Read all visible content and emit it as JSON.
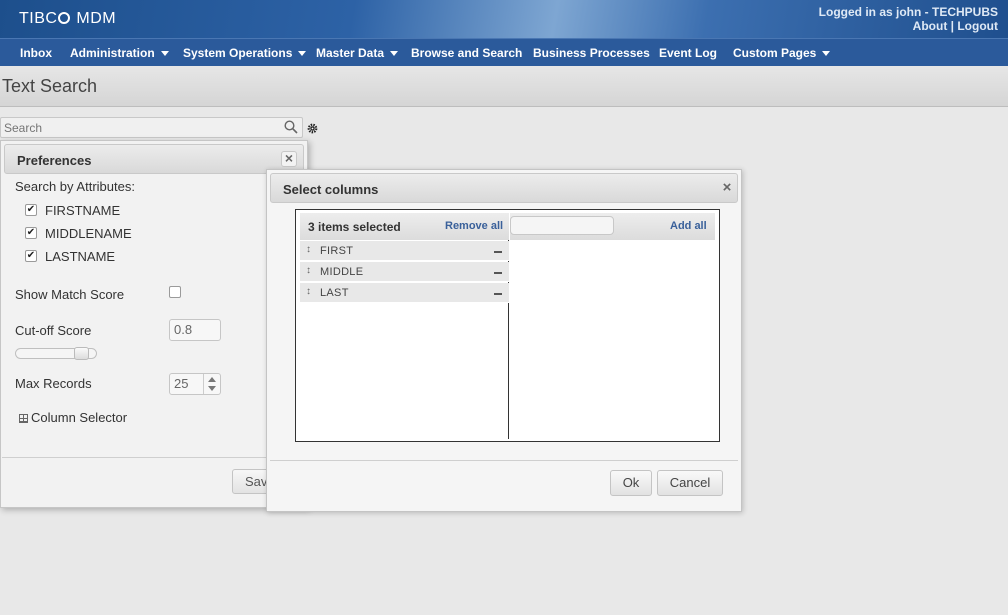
{
  "app": {
    "logo_text_left": "TIBC",
    "logo_text_right": " MDM",
    "logged_in": "Logged in as  john - TECHPUBS",
    "about": "About",
    "separator": " | ",
    "logout": "Logout"
  },
  "nav": {
    "items": [
      {
        "label": "Inbox",
        "dropdown": false
      },
      {
        "label": "Administration",
        "dropdown": true
      },
      {
        "label": "System Operations",
        "dropdown": true
      },
      {
        "label": "Master Data",
        "dropdown": true
      },
      {
        "label": "Browse and Search",
        "dropdown": false
      },
      {
        "label": "Business Processes",
        "dropdown": false
      },
      {
        "label": "Event Log",
        "dropdown": false
      },
      {
        "label": "Custom Pages",
        "dropdown": true
      }
    ]
  },
  "page": {
    "title": "Text Search"
  },
  "search": {
    "placeholder": "Search"
  },
  "preferences": {
    "title": "Preferences",
    "close": "×",
    "search_by_label": "Search by Attributes:",
    "attributes": [
      {
        "label": "FIRSTNAME",
        "checked": true
      },
      {
        "label": "MIDDLENAME",
        "checked": true
      },
      {
        "label": "LASTNAME",
        "checked": true
      }
    ],
    "show_match_score_label": "Show Match Score",
    "show_match_score_checked": false,
    "cutoff_label": "Cut-off Score",
    "cutoff_value": "0.8",
    "max_records_label": "Max Records",
    "max_records_value": "25",
    "column_selector_label": "Column Selector",
    "save_label": "Save"
  },
  "dialog": {
    "title": "Select columns",
    "close": "×",
    "selected_count": "3 items selected",
    "remove_all": "Remove all",
    "add_all": "Add all",
    "selected_columns": [
      "FIRST",
      "MIDDLE",
      "LAST"
    ],
    "drag_glyph": "↕",
    "ok_label": "Ok",
    "cancel_label": "Cancel"
  },
  "glyphs": {
    "check": "✔"
  }
}
